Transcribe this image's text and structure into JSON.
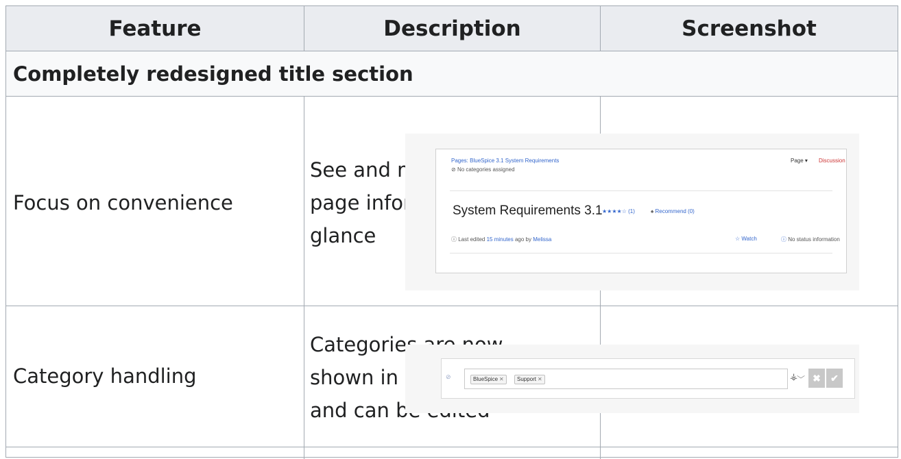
{
  "table": {
    "headers": [
      "Feature",
      "Description",
      "Screenshot"
    ],
    "section_title": "Completely redesigned title section",
    "rows": [
      {
        "feature": "Focus on convenience",
        "description_lines": [
          "See and modify relevant",
          "page information at a",
          "glance"
        ]
      },
      {
        "feature": "Category handling",
        "description_lines": [
          "Categories are now",
          "shown in the title section",
          "and can be edited"
        ]
      }
    ]
  },
  "screenshot1": {
    "breadcrumb": "Pages: BlueSpice 3.1 System Requirements",
    "categories": "No categories assigned",
    "page_menu": "Page ▾",
    "discussion": "Discussion",
    "title": "System Requirements 3.1",
    "rating": "★★★★☆ (1)",
    "recommend": "Recommend (0)",
    "last_edited_prefix": "Last edited",
    "last_edited_time": "15 minutes",
    "last_edited_mid": "ago by",
    "last_edited_user": "Melissa",
    "watch": "Watch",
    "status": "No status information"
  },
  "screenshot2": {
    "chips": [
      "BlueSpice",
      "Support"
    ]
  }
}
